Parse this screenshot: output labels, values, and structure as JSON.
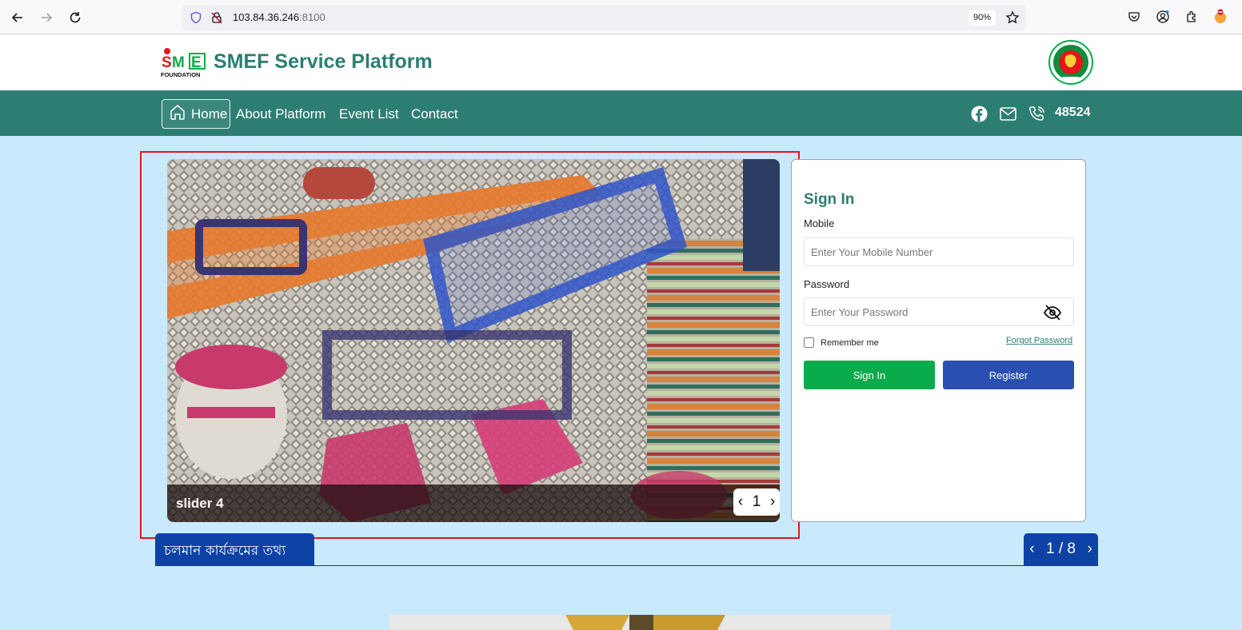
{
  "browser": {
    "url_host": "103.84.36.246",
    "url_port": ":8100",
    "zoom": "90%"
  },
  "header": {
    "site_title": "SMEF Service Platform",
    "logo_text": "SME FOUNDATION"
  },
  "nav": {
    "items": [
      {
        "label": "Home",
        "active": true
      },
      {
        "label": "About Platform"
      },
      {
        "label": "Event List"
      },
      {
        "label": "Contact"
      }
    ],
    "phone": "48524"
  },
  "slider": {
    "caption": "slider 4",
    "pager": {
      "prev": "‹",
      "current": "1",
      "next": "›"
    }
  },
  "signin": {
    "title": "Sign In",
    "mobile_label": "Mobile",
    "mobile_placeholder": "Enter Your Mobile Number",
    "password_label": "Password",
    "password_placeholder": "Enter Your Password",
    "remember_label": "Remember me",
    "forgot_label": "Forgot Password",
    "signin_button": "Sign In",
    "register_button": "Register"
  },
  "programs": {
    "tab_label": "চলমান কার্যক্রমের তথ্য",
    "pager": {
      "prev": "‹",
      "page": "1 / 8",
      "next": "›"
    }
  },
  "colors": {
    "brand": "#2d7e72",
    "page_bg": "#c9eafc",
    "signin": "#0aab4a",
    "register": "#2a4fb2",
    "program_tab": "#0e42a5",
    "highlight": "#e3161b"
  }
}
